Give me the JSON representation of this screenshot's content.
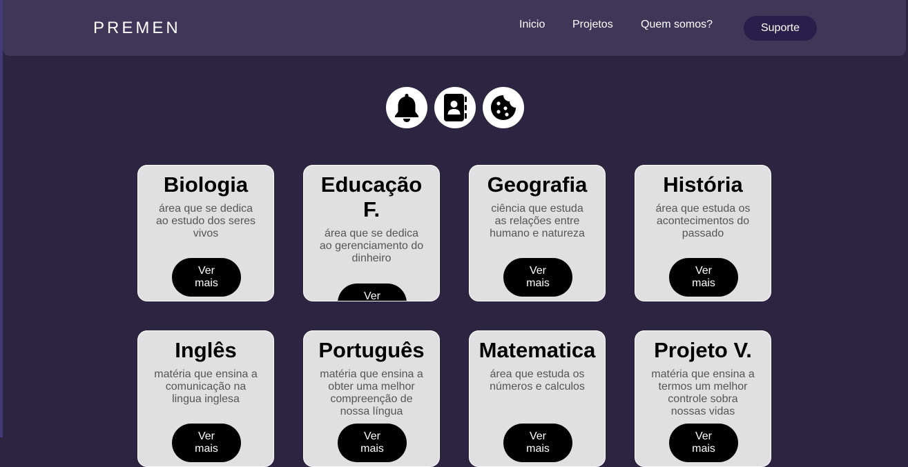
{
  "nav": {
    "brand": "PREMEN",
    "links": [
      "Inicio",
      "Projetos",
      "Quem somos?"
    ],
    "support": "Suporte"
  },
  "icons": [
    "bell-icon",
    "contact-book-icon",
    "cookie-icon"
  ],
  "cards": [
    {
      "title": "Biologia",
      "desc": "área que se dedica ao estudo dos seres vivos",
      "button": "Ver mais"
    },
    {
      "title": "Educação F.",
      "desc": "área que se dedica ao gerenciamento do dinheiro",
      "button": "Ver mais"
    },
    {
      "title": "Geografia",
      "desc": "ciência que estuda as relações entre humano e natureza",
      "button": "Ver mais"
    },
    {
      "title": "História",
      "desc": "área que estuda os acontecimentos do passado",
      "button": "Ver mais"
    },
    {
      "title": "Inglês",
      "desc": "matéria que ensina a comunicação na lingua inglesa",
      "button": "Ver mais"
    },
    {
      "title": "Português",
      "desc": "matéria que ensina a obter uma melhor compreenção de nossa língua",
      "button": "Ver mais"
    },
    {
      "title": "Matematica",
      "desc": "área que estuda os números e calculos",
      "button": "Ver mais"
    },
    {
      "title": "Projeto V.",
      "desc": "matéria que ensina a termos um melhor controle sobra nossas vidas",
      "button": "Ver mais"
    }
  ]
}
